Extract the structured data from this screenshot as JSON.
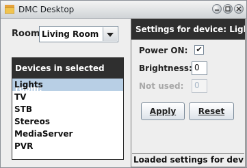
{
  "window": {
    "title": "DMC Desktop",
    "icons": [
      "app-icon",
      "minimize-icon",
      "maximize-icon",
      "close-icon"
    ]
  },
  "room": {
    "label": "Room:",
    "selected": "Living Room"
  },
  "devices": {
    "header": "Devices in selected room:",
    "items": [
      "Lights",
      "TV",
      "STB",
      "Stereos",
      "MediaServer",
      "PVR"
    ],
    "selected_index": 0
  },
  "settings": {
    "header": "Settings for device:  Lights",
    "power_label": "Power ON:",
    "power_checked": "✔",
    "brightness_label": "Brightness:",
    "brightness_value": "0",
    "not_used_label": "Not used:",
    "not_used_value": "0",
    "apply_label": "Apply",
    "reset_label": "Reset"
  },
  "status": {
    "text": "Loaded settings for device ..."
  },
  "colors": {
    "header_bg": "#2f2f2f",
    "selection": "#b8cfe5"
  }
}
